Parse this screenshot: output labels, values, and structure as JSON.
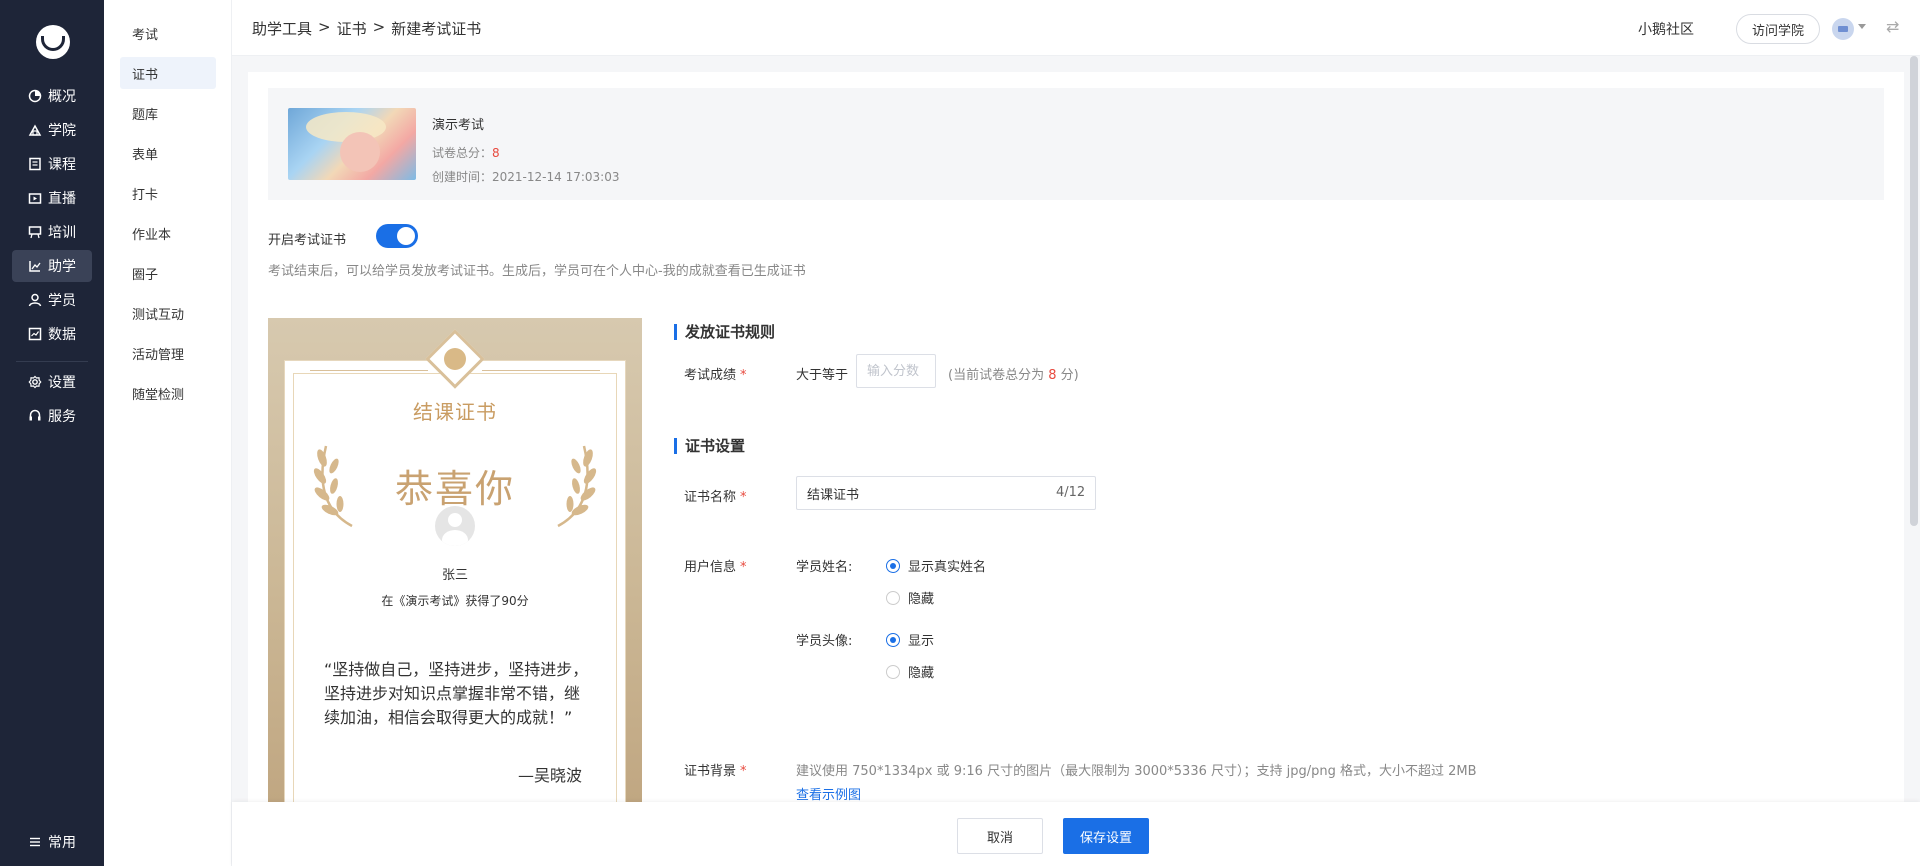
{
  "nav": {
    "items": [
      {
        "label": "概况",
        "icon": "pie-chart-icon"
      },
      {
        "label": "学院",
        "icon": "academy-icon"
      },
      {
        "label": "课程",
        "icon": "course-icon"
      },
      {
        "label": "直播",
        "icon": "live-icon"
      },
      {
        "label": "培训",
        "icon": "training-icon"
      },
      {
        "label": "助学",
        "icon": "study-aid-icon"
      },
      {
        "label": "学员",
        "icon": "student-icon"
      },
      {
        "label": "数据",
        "icon": "data-icon"
      },
      {
        "label": "设置",
        "icon": "settings-icon"
      },
      {
        "label": "服务",
        "icon": "service-icon"
      }
    ],
    "common": "常用",
    "active": "助学"
  },
  "submenu": {
    "items": [
      "考试",
      "证书",
      "题库",
      "表单",
      "打卡",
      "作业本",
      "圈子",
      "测试互动",
      "活动管理",
      "随堂检测"
    ],
    "active": "证书"
  },
  "header": {
    "breadcrumb": [
      "助学工具",
      ">",
      "证书",
      ">",
      "新建考试证书"
    ],
    "community": "小鹅社区",
    "visit": "访问学院"
  },
  "exam": {
    "title": "演示考试",
    "score_label": "试卷总分：",
    "score": "8",
    "created_label": "创建时间：",
    "created": "2021-12-14 17:03:03"
  },
  "toggle": {
    "label": "开启考试证书",
    "enabled": true,
    "hint": "考试结束后，可以给学员发放考试证书。生成后，学员可在个人中心-我的成就查看已生成证书"
  },
  "certificate": {
    "title": "结课证书",
    "congrats": "恭喜你",
    "student_name": "张三",
    "desc": "在《演示考试》获得了90分",
    "quote": "“坚持做自己，坚持进步，坚持进步，坚持进步对知识点掌握非常不错，继续加油，相信会取得更大的成就！”",
    "signature": "—吴晓波"
  },
  "rules": {
    "section_title": "发放证书规则",
    "score_label": "考试成绩",
    "score_prefix": "大于等于",
    "score_placeholder": "输入分数",
    "score_note_pre": "(当前试卷总分为",
    "score_note_value": "8",
    "score_note_post": "分)"
  },
  "settings": {
    "section_title": "证书设置",
    "name_label": "证书名称",
    "name_value": "结课证书",
    "name_count": "4/12",
    "user_info_label": "用户信息",
    "student_name_label": "学员姓名:",
    "name_options": [
      "显示真实姓名",
      "隐藏"
    ],
    "avatar_label": "学员头像:",
    "avatar_options": [
      "显示",
      "隐藏"
    ],
    "bg_label": "证书背景",
    "bg_hint": "建议使用 750*1334px 或 9:16 尺寸的图片（最大限制为 3000*5336 尺寸）；支持 jpg/png 格式，大小不超过 2MB",
    "bg_link": "查看示例图"
  },
  "footer": {
    "cancel": "取消",
    "save": "保存设置"
  },
  "colors": {
    "primary": "#1a6fe6",
    "nav_bg": "#1e2538",
    "required": "#e84a3f",
    "cert_gold": "#c9a271"
  }
}
